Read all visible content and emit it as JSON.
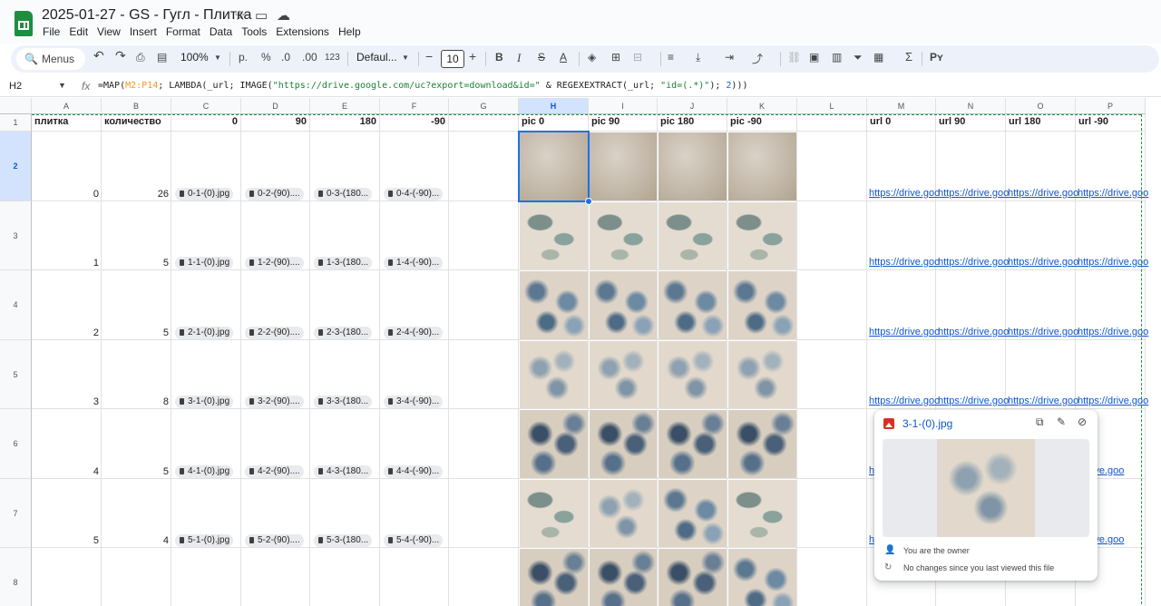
{
  "app": {
    "title": "2025-01-27 - GS - Гугл - Плитка",
    "star_icon": "star-icon",
    "move_icon": "folder-move-icon",
    "cloud_icon": "cloud-status-icon"
  },
  "menu": [
    "File",
    "Edit",
    "View",
    "Insert",
    "Format",
    "Data",
    "Tools",
    "Extensions",
    "Help"
  ],
  "toolbar": {
    "search_label": "Menus",
    "zoom": "100%",
    "currency": "р.",
    "percent": "%",
    "dec_decrease": ".0",
    "dec_increase": ".00",
    "more_formats": "123",
    "font": "Defaul...",
    "font_size": "10",
    "bold": "B",
    "italic": "I",
    "strike": "S",
    "text_color": "A",
    "minus": "−",
    "plus": "+",
    "sigma": "Σ"
  },
  "formula_bar": {
    "cell_ref": "H2",
    "fx": "fx",
    "parts": [
      "=MAP(",
      "M2:P14",
      "; LAMBDA(_url; IMAGE(",
      "\"https://drive.google.com/uc?export=download&id=\"",
      " & REGEXEXTRACT(_url; ",
      "\"id=(.*)\"",
      "); ",
      "2",
      ")))"
    ]
  },
  "columns": [
    "A",
    "B",
    "C",
    "D",
    "E",
    "F",
    "G",
    "H",
    "I",
    "J",
    "K",
    "L",
    "M",
    "N",
    "O",
    "P"
  ],
  "selected_column": "H",
  "header_row": {
    "A": "плитка",
    "B": "количество",
    "C": "0",
    "D": "90",
    "E": "180",
    "F": "-90",
    "G": "",
    "H": "pic 0",
    "I": "pic 90",
    "J": "pic 180",
    "K": "pic -90",
    "L": "",
    "M": "url 0",
    "N": "url 90",
    "O": "url 180",
    "P": "url -90"
  },
  "rows": [
    {
      "num": "2",
      "plitka": "0",
      "qty": "26",
      "files": [
        "0-1-(0).jpg",
        "0-2-(90)....",
        "0-3-(180...",
        "0-4-(-90)..."
      ],
      "tiles": [
        "plain",
        "plain",
        "plain",
        "plain"
      ],
      "links": [
        "https://drive.goo",
        "https://drive.goo",
        "https://drive.goo",
        "https://drive.goo"
      ]
    },
    {
      "num": "3",
      "plitka": "1",
      "qty": "5",
      "files": [
        "1-1-(0).jpg",
        "1-2-(90)....",
        "1-3-(180...",
        "1-4-(-90)..."
      ],
      "tiles": [
        "leaf",
        "leaf",
        "leaf",
        "leaf"
      ],
      "links": [
        "https://drive.goo",
        "https://drive.goo",
        "https://drive.goo",
        "https://drive.goo"
      ]
    },
    {
      "num": "4",
      "plitka": "2",
      "qty": "5",
      "files": [
        "2-1-(0).jpg",
        "2-2-(90)....",
        "2-3-(180...",
        "2-4-(-90)..."
      ],
      "tiles": [
        "blue",
        "blue",
        "blue",
        "blue"
      ],
      "links": [
        "https://drive.goo",
        "https://drive.goo",
        "https://drive.goo",
        "https://drive.goo"
      ]
    },
    {
      "num": "5",
      "plitka": "3",
      "qty": "8",
      "files": [
        "3-1-(0).jpg",
        "3-2-(90)....",
        "3-3-(180...",
        "3-4-(-90)..."
      ],
      "tiles": [
        "pale",
        "pale",
        "pale",
        "pale"
      ],
      "links": [
        "https://drive.goo",
        "https://drive.goo",
        "https://drive.goo",
        "https://drive.goo"
      ]
    },
    {
      "num": "6",
      "plitka": "4",
      "qty": "5",
      "files": [
        "4-1-(0).jpg",
        "4-2-(90)....",
        "4-3-(180...",
        "4-4-(-90)..."
      ],
      "tiles": [
        "dark",
        "dark",
        "dark",
        "dark"
      ],
      "links": [
        "htt",
        "",
        "",
        "//drive.goo"
      ]
    },
    {
      "num": "7",
      "plitka": "5",
      "qty": "4",
      "files": [
        "5-1-(0).jpg",
        "5-2-(90)....",
        "5-3-(180...",
        "5-4-(-90)..."
      ],
      "tiles": [
        "leaf",
        "pale",
        "blue",
        "leaf"
      ],
      "links": [
        "http",
        "",
        "",
        "//drive.goo"
      ]
    },
    {
      "num": "8",
      "plitka": "",
      "qty": "",
      "files": [
        "",
        "",
        "",
        ""
      ],
      "tiles": [
        "dark",
        "dark",
        "dark",
        "blue"
      ],
      "links": [
        "",
        "",
        "",
        ""
      ]
    }
  ],
  "popup": {
    "filename": "3-1-(0).jpg",
    "file_icon": "image-file-icon",
    "copy_icon": "copy-icon",
    "edit_icon": "pencil-icon",
    "remove_icon": "remove-chip-icon",
    "owner_text": "You are the owner",
    "changes_text": "No changes since you last viewed this file",
    "person_icon": "person-icon",
    "history_icon": "history-icon"
  }
}
